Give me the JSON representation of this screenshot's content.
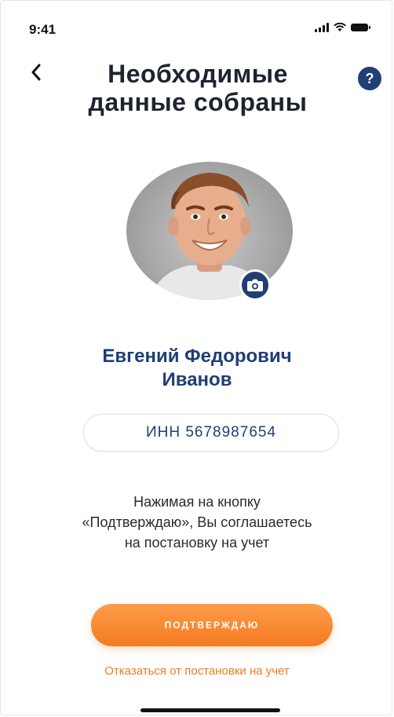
{
  "status_bar": {
    "time": "9:41"
  },
  "header": {
    "back_icon": "chevron-left-icon",
    "title_line1": "Необходимые",
    "title_line2": "данные собраны",
    "help_label": "?"
  },
  "profile": {
    "avatar_icon": "avatar",
    "camera_icon": "camera-icon",
    "name_line1": "Евгений Федорович",
    "name_line2": "Иванов",
    "inn": "ИНН 5678987654"
  },
  "consent": {
    "line1": "Нажимая на кнопку",
    "line2": "«Подтверждаю», Вы соглашаетесь",
    "line3": "на постановку на учет"
  },
  "actions": {
    "confirm_label": "ПОДТВЕРЖДАЮ",
    "decline_label": "Отказаться от постановки на учет"
  },
  "colors": {
    "accent_navy": "#1f3f75",
    "accent_orange": "#f37a1f"
  }
}
